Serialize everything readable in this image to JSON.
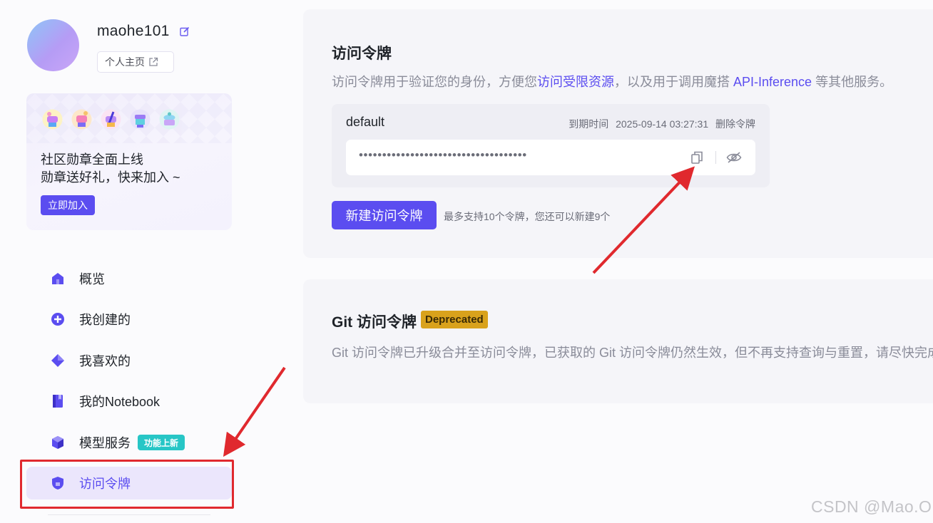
{
  "colors": {
    "accent": "#5b4df0",
    "highlight_red": "#e0292e",
    "new_tag": "#27c6c6",
    "deprecated_tag": "#d9a21c"
  },
  "profile": {
    "username": "maohe101",
    "homepage_label": "个人主页"
  },
  "promo": {
    "line1": "社区勋章全面上线",
    "line2": "勋章送好礼，快来加入 ~",
    "join_label": "立即加入"
  },
  "nav": {
    "items": [
      {
        "label": "概览",
        "icon": "home-icon"
      },
      {
        "label": "我创建的",
        "icon": "plus-circle-icon"
      },
      {
        "label": "我喜欢的",
        "icon": "diamond-icon"
      },
      {
        "label": "我的Notebook",
        "icon": "notebook-icon"
      },
      {
        "label": "模型服务",
        "icon": "cube-icon",
        "tag": "功能上新"
      },
      {
        "label": "访问令牌",
        "icon": "shield-icon",
        "active": true
      }
    ]
  },
  "access_token": {
    "title": "访问令牌",
    "desc_before": "访问令牌用于验证您的身份，方便您",
    "desc_link1": "访问受限资源",
    "desc_middle": "，以及用于调用魔搭 ",
    "desc_link2": "API-Inference",
    "desc_after": " 等其他服务。",
    "token": {
      "name": "default",
      "expiry_label": "到期时间",
      "expiry_value": "2025-09-14 03:27:31",
      "delete_label": "删除令牌",
      "masked_value": "••••••••••••••••••••••••••••••••••••"
    },
    "new_button_label": "新建访问令牌",
    "limit_note": "最多支持10个令牌，您还可以新建9个"
  },
  "git_token": {
    "title": "Git 访问令牌",
    "tag": "Deprecated",
    "desc": "Git 访问令牌已升级合并至访问令牌，已获取的 Git 访问令牌仍然生效，但不再支持查询与重置，请尽快完成升"
  },
  "watermark": "CSDN @Mao.O"
}
